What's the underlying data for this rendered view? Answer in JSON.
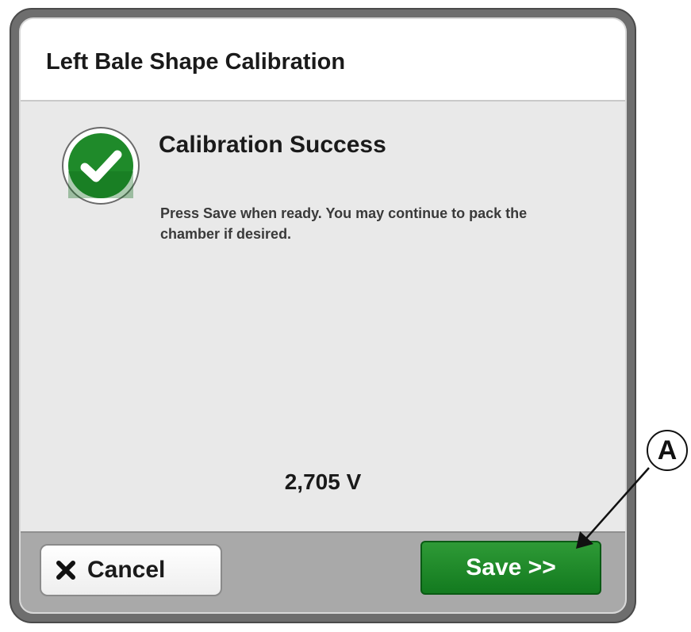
{
  "dialog": {
    "title": "Left Bale Shape Calibration",
    "headline": "Calibration Success",
    "message": "Press Save when ready. You may continue to pack the chamber if desired.",
    "reading": "2,705 V",
    "status_icon": "check-circle-icon"
  },
  "buttons": {
    "cancel_label": "Cancel",
    "cancel_icon": "close-x-icon",
    "save_label": "Save >>"
  },
  "callout": {
    "label": "A"
  },
  "colors": {
    "success_green": "#1f8a2a",
    "save_button": "#137a1f",
    "footer_bar": "#a9a9a9"
  }
}
